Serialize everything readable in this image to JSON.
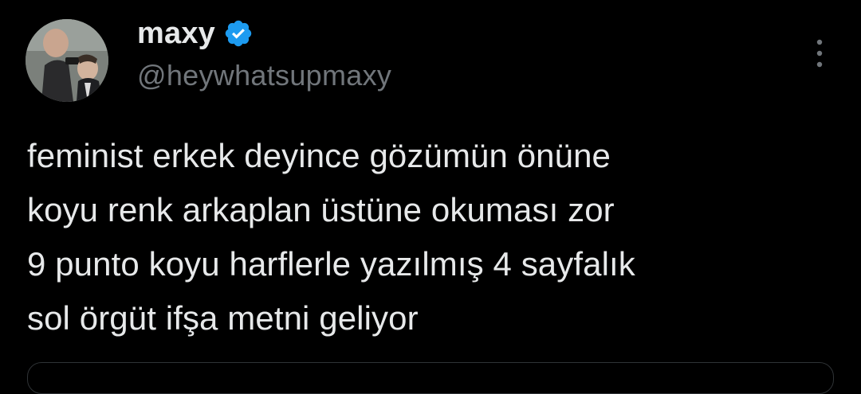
{
  "user": {
    "display_name": "maxy",
    "handle": "@heywhatsupmaxy",
    "verified": true,
    "avatar_icon": "profile-photo"
  },
  "tweet": {
    "text": "feminist erkek deyince gözümün önüne\nkoyu renk arkaplan üstüne okuması zor\n9 punto koyu harflerle yazılmış 4 sayfalık\nsol örgüt ifşa metni geliyor"
  },
  "icons": {
    "verified": "verified-badge-icon",
    "more": "more-options-icon"
  },
  "colors": {
    "background": "#000000",
    "text": "#e7e9ea",
    "secondary_text": "#71767b",
    "verified_blue": "#1d9bf0",
    "border": "#2f3336"
  }
}
